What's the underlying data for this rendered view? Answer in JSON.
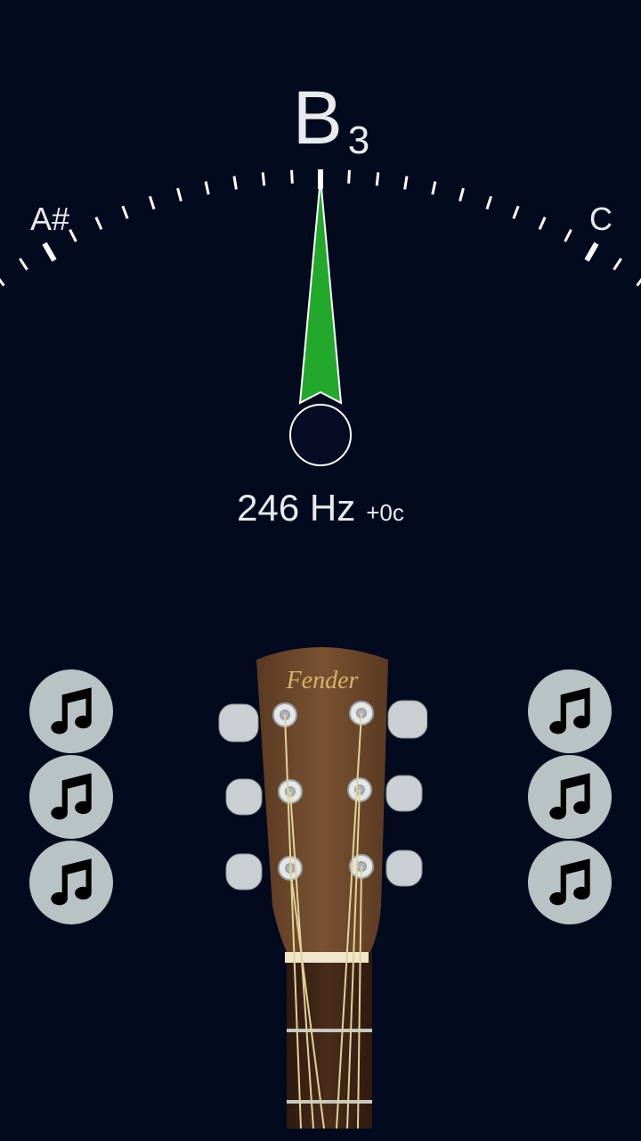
{
  "tuner": {
    "note": "B",
    "octave": "3",
    "prev_note": "A#",
    "next_note": "C",
    "frequency": "246 Hz",
    "cents": "+0c",
    "needle_color": "#22a82a"
  },
  "headstock": {
    "brand": "Fender"
  },
  "string_buttons": {
    "left": [
      {
        "icon": "music-note-icon"
      },
      {
        "icon": "music-note-icon"
      },
      {
        "icon": "music-note-icon"
      }
    ],
    "right": [
      {
        "icon": "music-note-icon"
      },
      {
        "icon": "music-note-icon"
      },
      {
        "icon": "music-note-icon"
      }
    ]
  },
  "colors": {
    "background": "#040a1e",
    "button": "#b9c2c4",
    "wood": "#6e4a2e"
  }
}
